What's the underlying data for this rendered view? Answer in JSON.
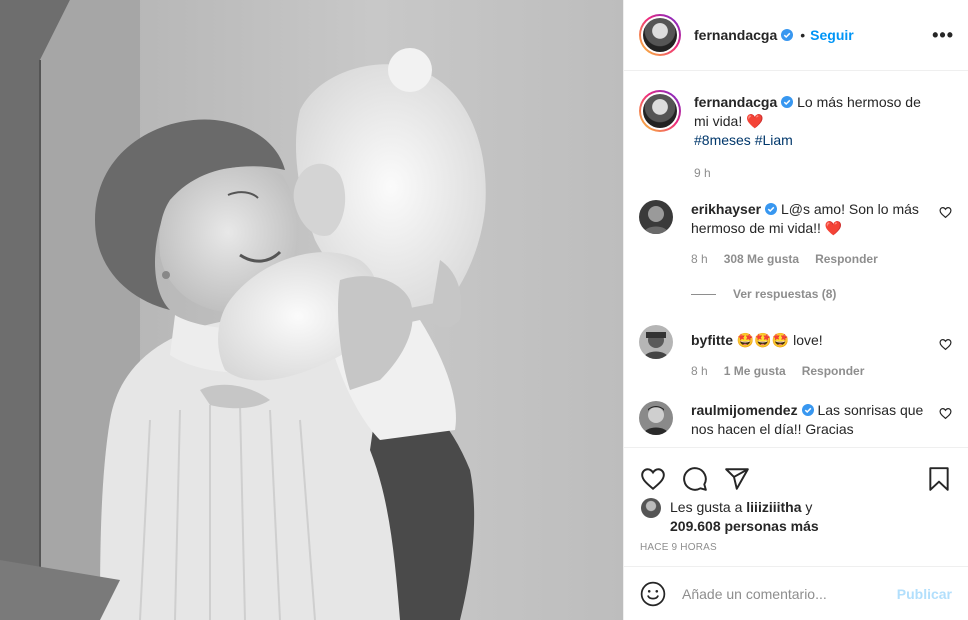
{
  "post": {
    "author": "fernandacga",
    "follow_label": "Seguir",
    "dot": "•",
    "more": "•••",
    "caption": "Lo más hermoso de mi vida!",
    "caption_emoji": "❤️",
    "hashtags": "#8meses #Liam",
    "caption_time": "9 h"
  },
  "comments": [
    {
      "user": "erikhayser",
      "verified": true,
      "text": "L@s amo! Son lo más hermoso de mi vida!!",
      "emoji": "❤️",
      "time": "8 h",
      "likes": "308 Me gusta",
      "reply": "Responder",
      "view_replies": "Ver respuestas (8)"
    },
    {
      "user": "byfitte",
      "verified": false,
      "emoji": "🤩🤩🤩",
      "text": "love!",
      "time": "8 h",
      "likes": "1 Me gusta",
      "reply": "Responder"
    },
    {
      "user": "raulmijomendez",
      "verified": true,
      "text": "Las sonrisas que nos hacen el día!! Gracias"
    }
  ],
  "likes": {
    "prefix": "Les gusta a",
    "user": "liiiziiitha",
    "middle": "y",
    "count": "209.608 personas más"
  },
  "time_ago": "HACE 9 HORAS",
  "add_comment": {
    "placeholder": "Añade un comentario...",
    "publish_label": "Publicar"
  },
  "icons": {
    "like": "heart-outline-icon",
    "comment": "comment-bubble-icon",
    "share": "paper-plane-icon",
    "save": "bookmark-icon",
    "emoji": "smiley-icon",
    "comment_like": "small-heart-icon",
    "verified": "verified-badge-icon"
  },
  "colors": {
    "link": "#0095f6",
    "hashtag": "#00376b",
    "muted": "#8e8e8e",
    "heart": "#ed4956",
    "publish_disabled": "#b2dffc"
  }
}
